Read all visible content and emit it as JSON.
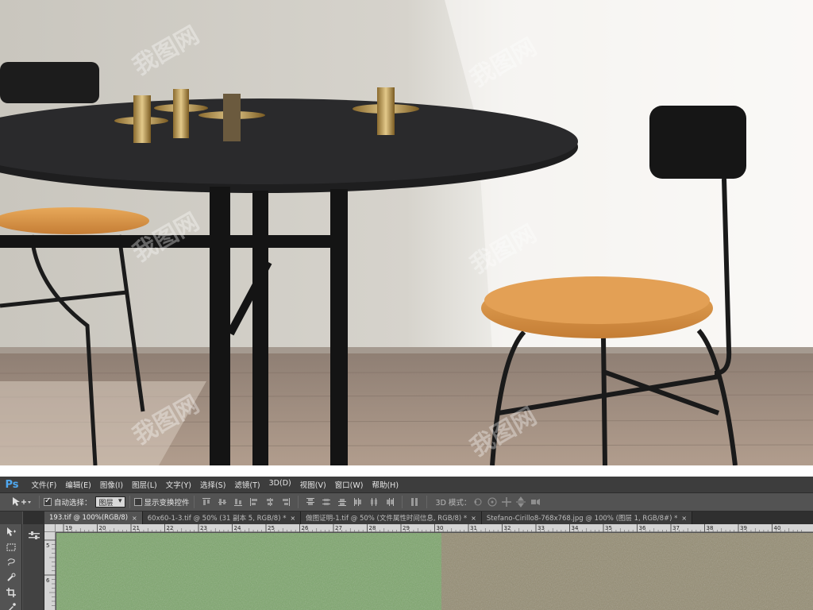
{
  "photo": {
    "watermark_text": "我图网"
  },
  "photoshop": {
    "logo": "Ps",
    "menu": [
      "文件(F)",
      "编辑(E)",
      "图像(I)",
      "图层(L)",
      "文字(Y)",
      "选择(S)",
      "滤镜(T)",
      "3D(D)",
      "视图(V)",
      "窗口(W)",
      "帮助(H)"
    ],
    "options": {
      "tool_icon": "move-tool-icon",
      "auto_select_label": "自动选择：",
      "auto_select_checked": true,
      "auto_select_target": "图层",
      "show_transform_label": "显示变换控件",
      "show_transform_checked": false,
      "mode_3d_label": "3D 模式："
    },
    "tabs": [
      {
        "label": "193.tif @ 100%(RGB/8)",
        "close": "×",
        "active": true
      },
      {
        "label": "60x60-1-3.tif @ 50% (31 副本 5, RGB/8) *",
        "close": "×",
        "active": false
      },
      {
        "label": "做图证明-1.tif @ 50% (文件属性时间信息, RGB/8) *",
        "close": "×",
        "active": false
      },
      {
        "label": "Stefano-Cirillo8-768x768.jpg @ 100% (图层 1, RGB/8#) *",
        "close": "×",
        "active": false
      }
    ],
    "ruler": {
      "h_labels": [
        "19",
        "20",
        "21",
        "22",
        "23",
        "24",
        "25",
        "26",
        "27",
        "28",
        "29",
        "30",
        "31",
        "32",
        "33",
        "34",
        "35",
        "36",
        "37",
        "38",
        "39",
        "40"
      ],
      "v_labels": [
        "5",
        "6"
      ]
    },
    "canvas": {
      "left_swatch_color": "#7da66c",
      "right_swatch_color": "#948c72"
    },
    "tools": [
      "move-tool-icon",
      "marquee-tool-icon",
      "lasso-tool-icon",
      "quick-select-tool-icon",
      "crop-tool-icon",
      "eyedropper-tool-icon"
    ]
  }
}
